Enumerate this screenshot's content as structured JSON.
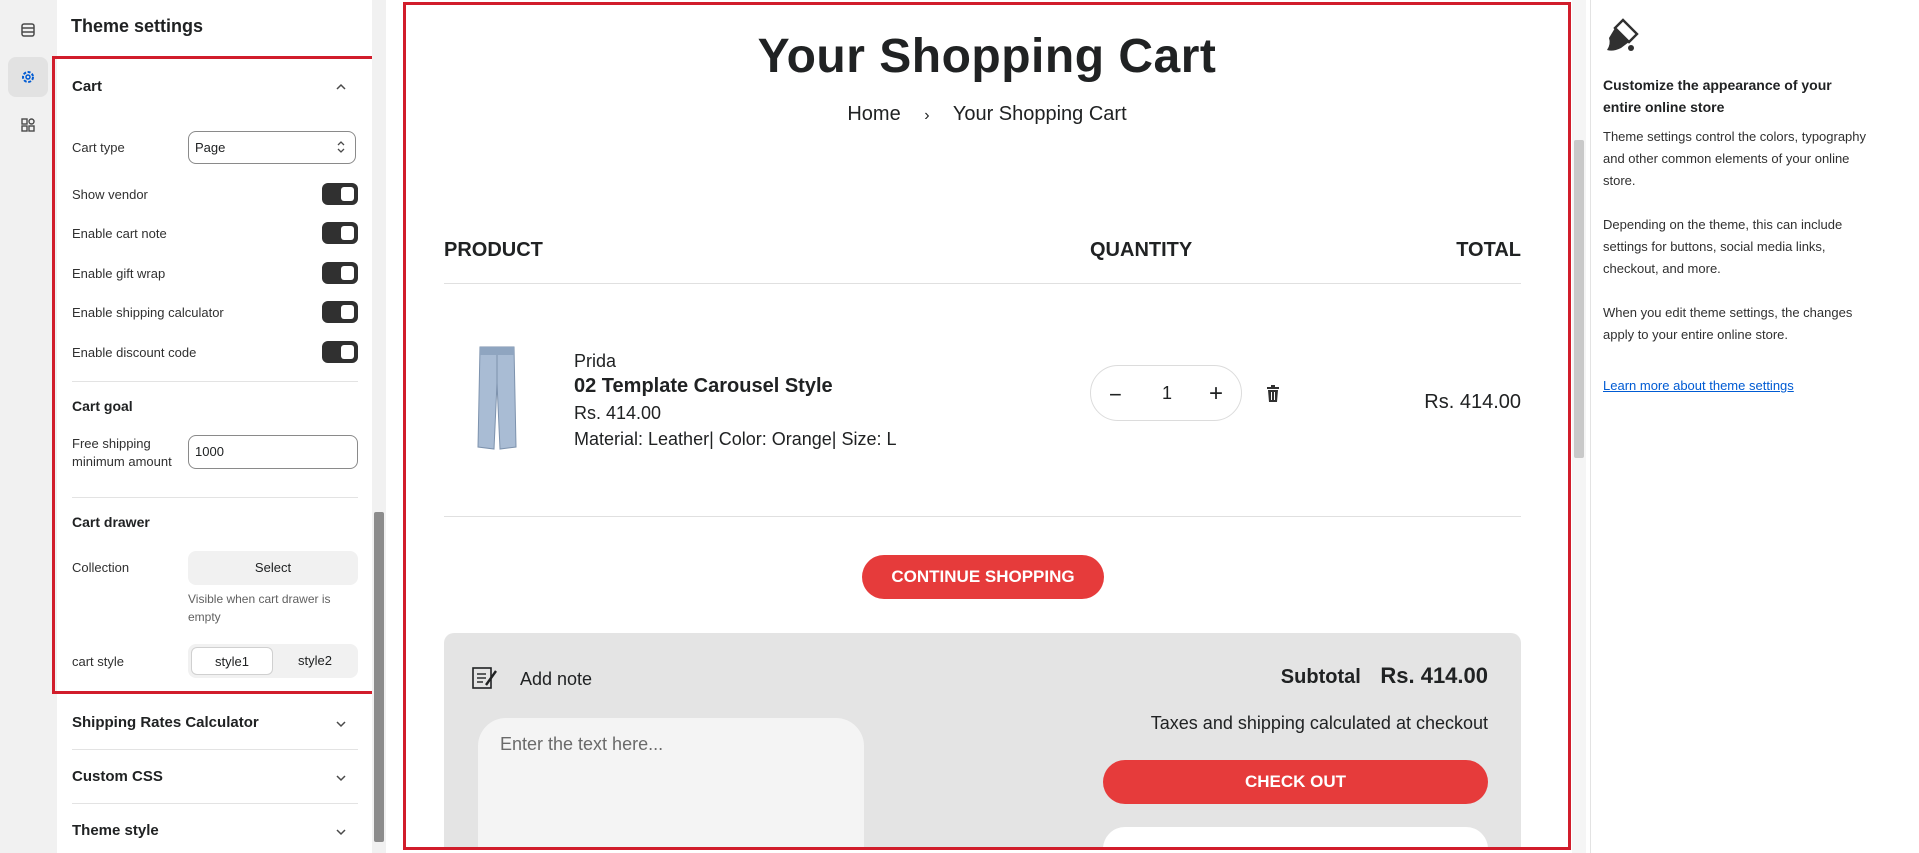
{
  "settings": {
    "title": "Theme settings",
    "cart": {
      "heading": "Cart",
      "cart_type_label": "Cart type",
      "cart_type_value": "Page",
      "toggles": [
        {
          "label": "Show vendor",
          "on": true
        },
        {
          "label": "Enable cart note",
          "on": true
        },
        {
          "label": "Enable gift wrap",
          "on": true
        },
        {
          "label": "Enable shipping calculator",
          "on": true
        },
        {
          "label": "Enable discount code",
          "on": true
        }
      ],
      "goal_heading": "Cart goal",
      "free_shipping_label_1": "Free shipping",
      "free_shipping_label_2": "minimum amount",
      "free_shipping_value": "1000",
      "drawer_heading": "Cart drawer",
      "collection_label": "Collection",
      "collection_button": "Select",
      "collection_help": "Visible when cart drawer is empty",
      "style_label": "cart style",
      "style_options": [
        "style1",
        "style2"
      ],
      "style_selected": "style1"
    },
    "sections": [
      "Shipping Rates Calculator",
      "Custom CSS",
      "Theme style"
    ]
  },
  "preview": {
    "title": "Your Shopping Cart",
    "breadcrumb": {
      "home": "Home",
      "separator": "›",
      "current": "Your Shopping Cart"
    },
    "columns": {
      "product": "PRODUCT",
      "quantity": "QUANTITY",
      "total": "TOTAL"
    },
    "item": {
      "vendor": "Prida",
      "name": "02 Template Carousel Style",
      "price": "Rs. 414.00",
      "variant": "Material: Leather|  Color: Orange|  Size: L",
      "quantity": "1",
      "line_total": "Rs. 414.00"
    },
    "continue_label": "CONTINUE SHOPPING",
    "note_label": "Add note",
    "note_placeholder": "Enter the text here...",
    "subtotal_label": "Subtotal",
    "subtotal_value": "Rs. 414.00",
    "taxes_text": "Taxes and shipping calculated at checkout",
    "checkout_label": "CHECK OUT"
  },
  "help": {
    "heading": "Customize the appearance of your entire online store",
    "p1": "Theme settings control the colors, typography and other common elements of your online store.",
    "p2": "Depending on the theme, this can include settings for buttons, social media links, checkout, and more.",
    "p3": "When you edit theme settings, the changes apply to your entire online store.",
    "link": "Learn more about theme settings"
  },
  "colors": {
    "accent_red": "#e63b3b",
    "highlight_border": "#d11d2b",
    "link": "#005bd3"
  }
}
